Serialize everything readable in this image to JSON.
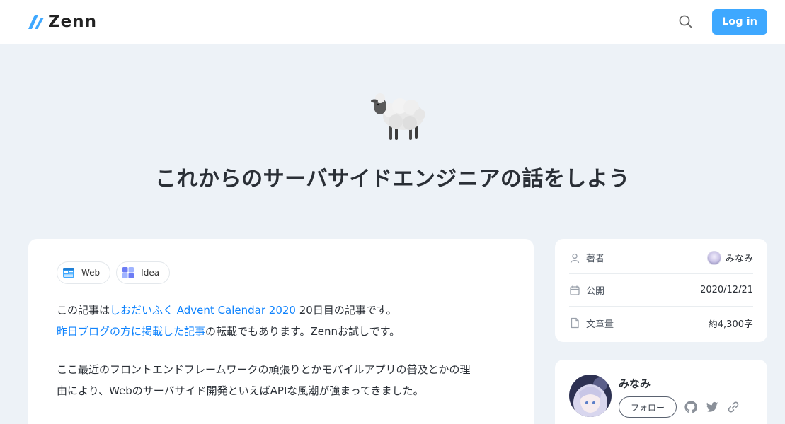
{
  "header": {
    "logo_text": "Zenn",
    "login_label": "Log in",
    "search_icon": "search-icon"
  },
  "hero": {
    "emoji": "sheep",
    "title": "これからのサーバサイドエンジニアの話をしよう"
  },
  "article": {
    "topics": [
      {
        "label": "Web",
        "icon": "web-icon"
      },
      {
        "label": "Idea",
        "icon": "idea-icon"
      }
    ],
    "paragraph1": {
      "prefix": "この記事は",
      "link1": "しおだいふく Advent Calendar 2020",
      "middle": " 20日目の記事です。",
      "link2": "昨日ブログの方に掲載した記事",
      "suffix": "の転載でもあります。Zennお試しです。"
    },
    "paragraph2": {
      "line1": "ここ最近のフロントエンドフレームワークの頑張りとかモバイルアプリの普及とかの理",
      "line2": "由により、Webのサーバサイド開発といえばAPIな風潮が強まってきました。"
    }
  },
  "info": {
    "author_label": "著者",
    "author_value": "みなみ",
    "published_label": "公開",
    "published_value": "2020/12/21",
    "length_label": "文章量",
    "length_value": "約4,300字"
  },
  "author_card": {
    "name": "みなみ",
    "follow_label": "フォロー"
  },
  "colors": {
    "accent": "#3ea8ff",
    "link": "#0f83fd",
    "page_bg": "#edf2f7"
  }
}
